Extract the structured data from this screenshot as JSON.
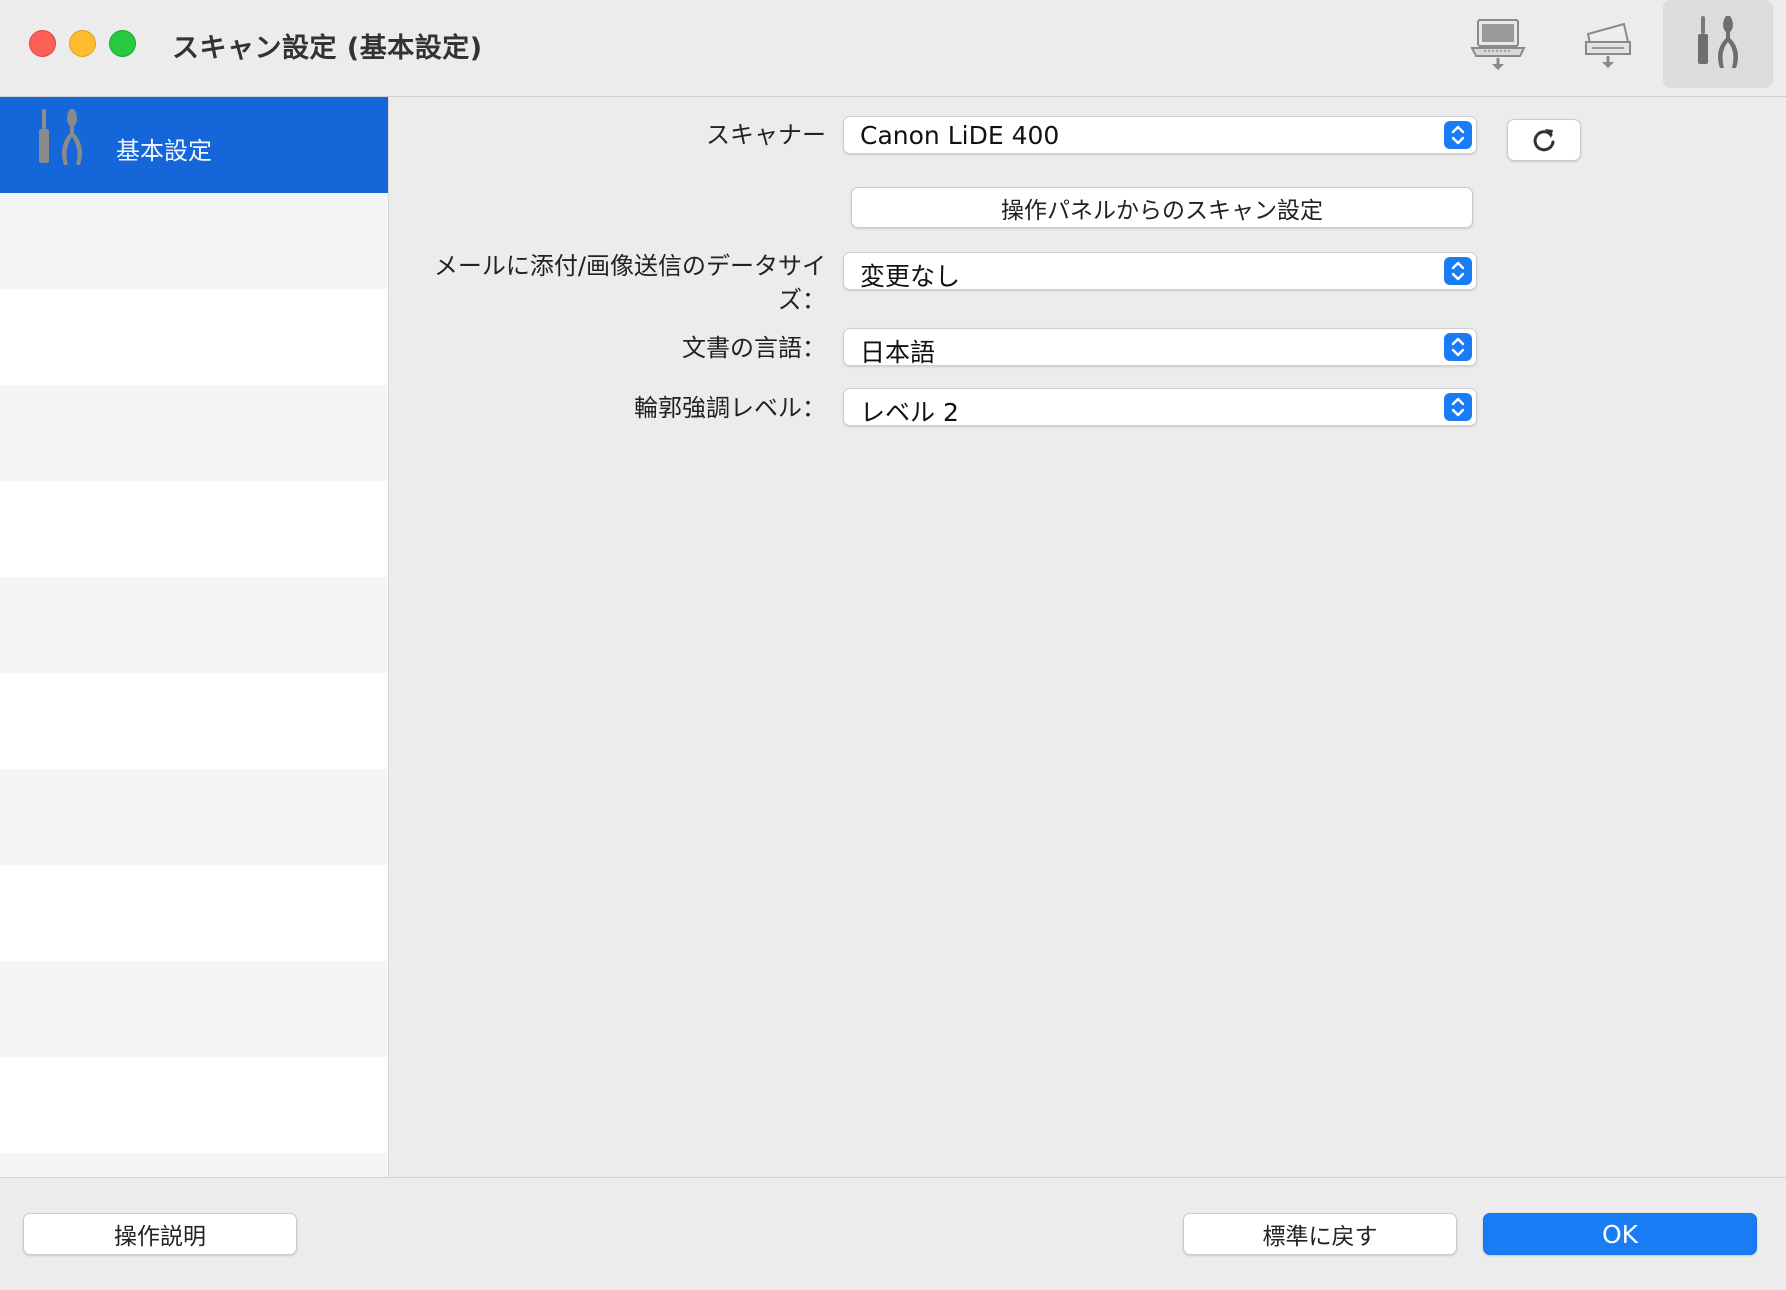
{
  "window": {
    "title": "スキャン設定 (基本設定)",
    "toolbar": [
      {
        "icon": "computer-scan-icon",
        "active": false
      },
      {
        "icon": "scanner-scan-icon",
        "active": false
      },
      {
        "icon": "tools-icon",
        "active": true
      }
    ]
  },
  "sidebar": {
    "items": [
      {
        "label": "基本設定",
        "icon": "tools-icon",
        "selected": true
      }
    ]
  },
  "form": {
    "scanner_label": "スキャナー",
    "scanner_value": "Canon LiDE 400",
    "panel_button": "操作パネルからのスキャン設定",
    "datasize_label_line1": "メールに添付/画像送信のデータサイ",
    "datasize_label_line2": "ズ：",
    "datasize_value": "変更なし",
    "language_label": "文書の言語：",
    "language_value": "日本語",
    "edge_label": "輪郭強調レベル：",
    "edge_value": "レベル 2"
  },
  "footer": {
    "help_button": "操作説明",
    "defaults_button": "標準に戻す",
    "ok_button": "OK"
  },
  "colors": {
    "accent": "#1a7cf4",
    "sidebar_selected": "#1566d8"
  }
}
